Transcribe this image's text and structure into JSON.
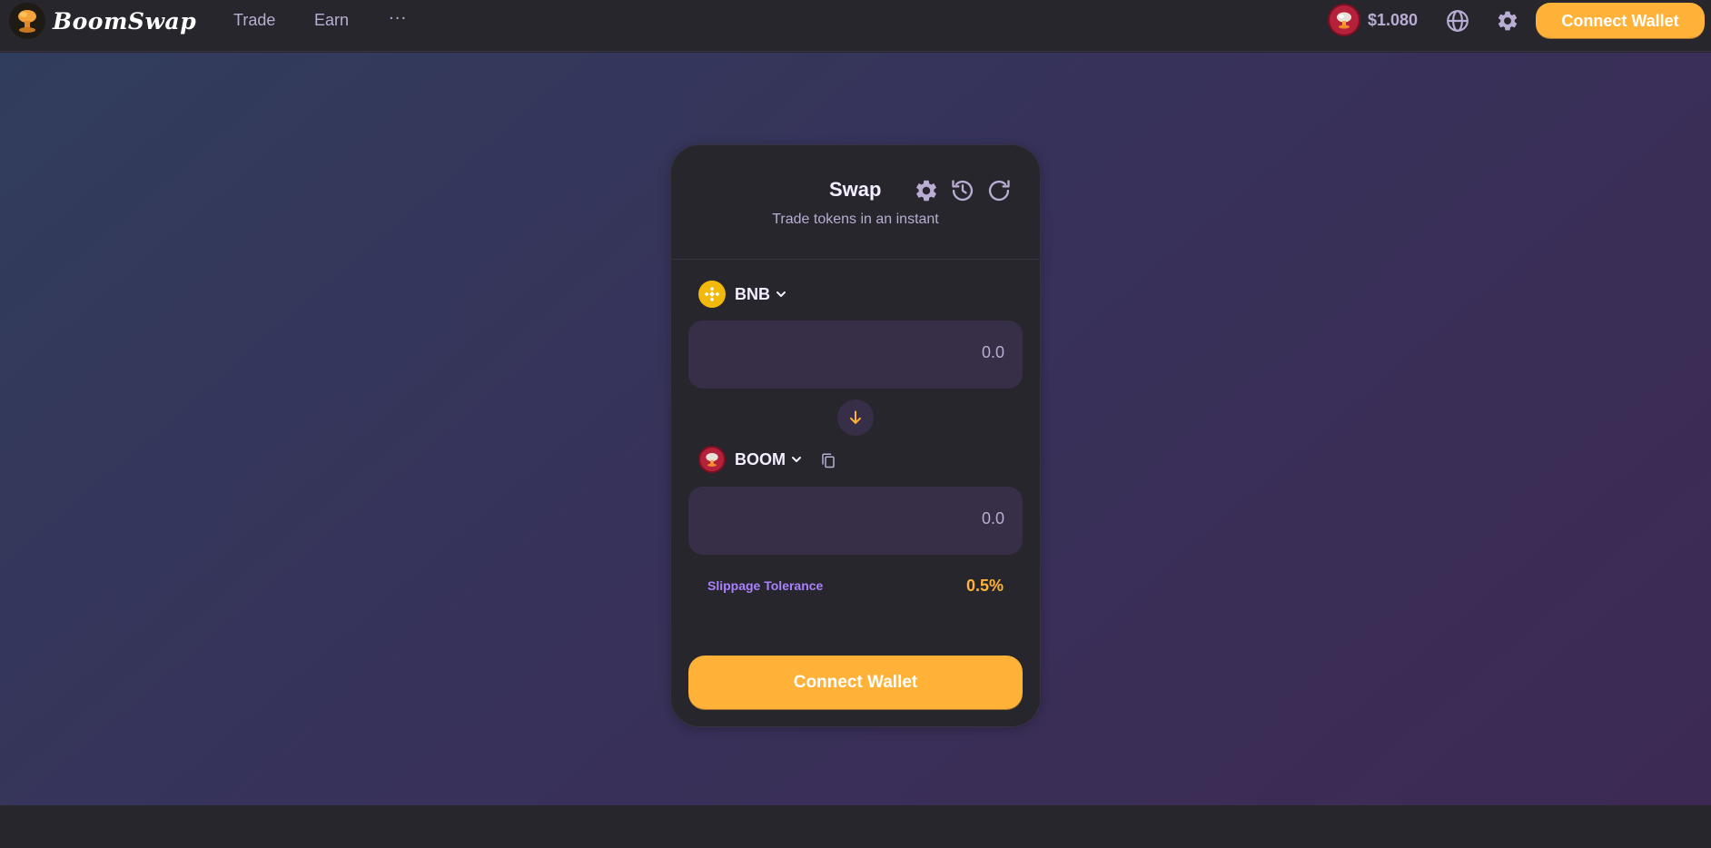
{
  "app": {
    "brand": "BoomSwap"
  },
  "nav": {
    "links": [
      "Trade",
      "Earn"
    ],
    "more_label": "···",
    "token_price": "$1.080",
    "connect_label": "Connect Wallet"
  },
  "swap": {
    "title": "Swap",
    "subtitle": "Trade tokens in an instant",
    "from_token": "BNB",
    "from_placeholder": "0.0",
    "to_token": "BOOM",
    "to_placeholder": "0.0",
    "slippage_label": "Slippage Tolerance",
    "slippage_value": "0.5%",
    "connect_label": "Connect Wallet"
  },
  "colors": {
    "accent": "#ffb237",
    "secondary": "#a881fc",
    "card_bg": "#27262c",
    "input_bg": "#372f47",
    "text_muted": "#b8add2"
  },
  "icons": [
    "logo-icon",
    "boom-token-icon",
    "globe-icon",
    "gear-icon",
    "history-icon",
    "refresh-icon",
    "bnb-icon",
    "chevron-down-icon",
    "arrow-down-icon",
    "copy-icon"
  ]
}
